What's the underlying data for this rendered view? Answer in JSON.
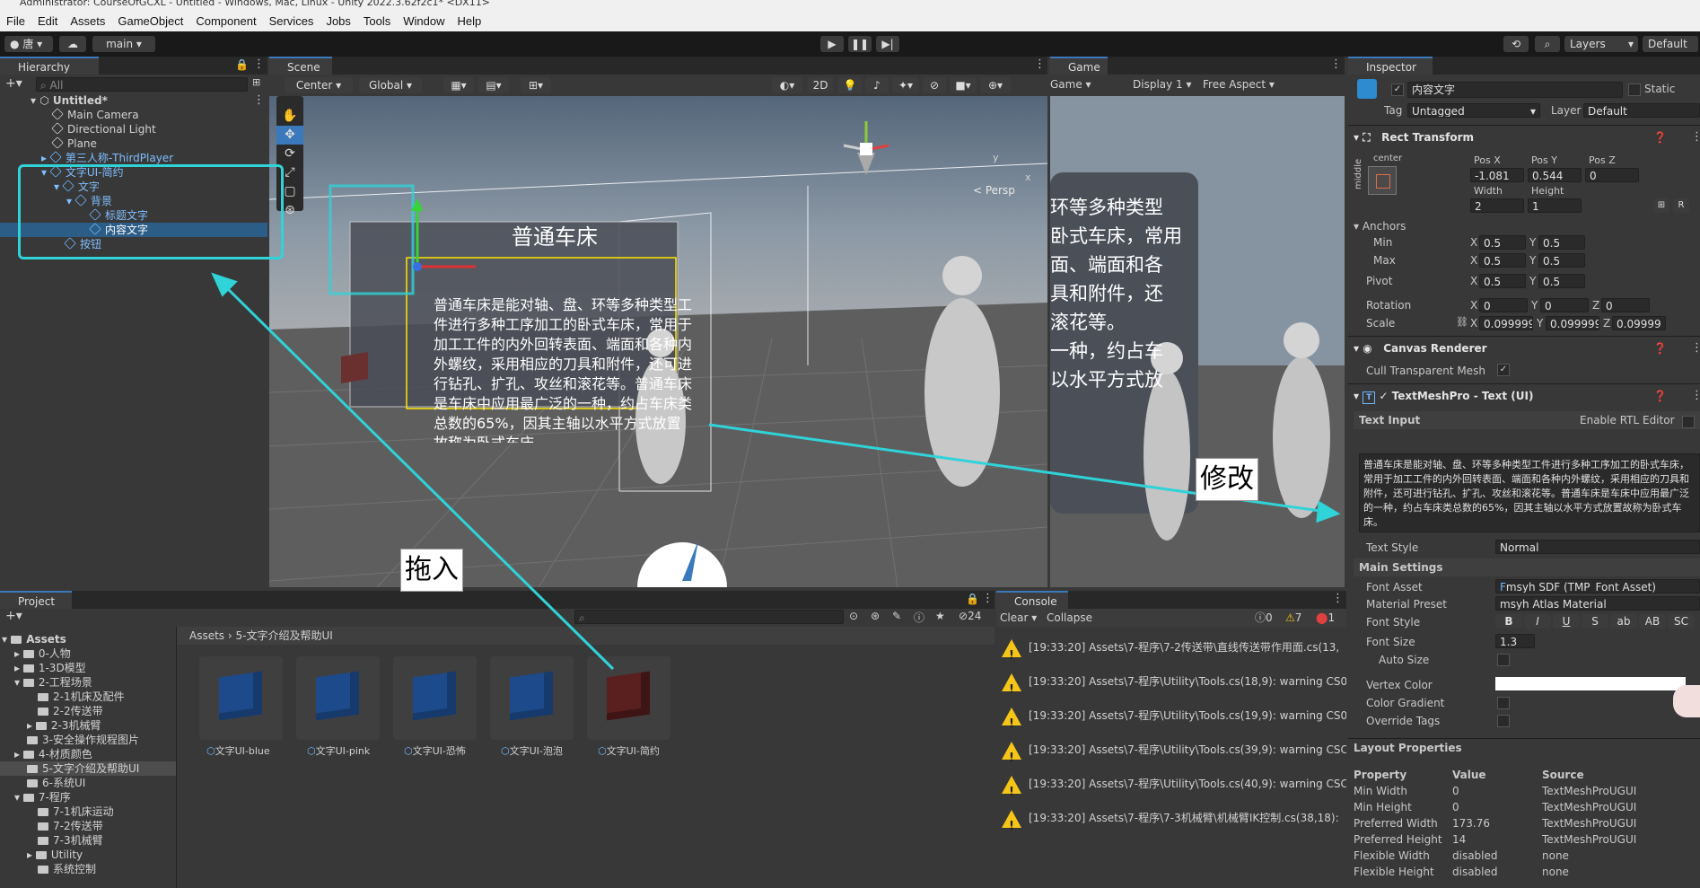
{
  "window": {
    "title": "Administrator: CourseOfGCXL - Untitled - Windows, Mac, Linux - Unity 2022.3.62f2c1* <DX11>"
  },
  "menu": [
    "File",
    "Edit",
    "Assets",
    "GameObject",
    "Component",
    "Services",
    "Jobs",
    "Tools",
    "Window",
    "Help"
  ],
  "toolbar": {
    "account": "唐",
    "branch": "main",
    "layers": "Layers",
    "layout": "Default"
  },
  "hierarchy": {
    "tab": "Hierarchy",
    "search_placeholder": "All",
    "scene": "Untitled*",
    "items": [
      {
        "label": "Main Camera"
      },
      {
        "label": "Directional Light"
      },
      {
        "label": "Plane"
      },
      {
        "label": "第三人称-ThirdPlayer"
      },
      {
        "label": "文字UI-简约"
      },
      {
        "label": "文字"
      },
      {
        "label": "背景"
      },
      {
        "label": "标题文字"
      },
      {
        "label": "内容文字"
      },
      {
        "label": "按钮"
      }
    ]
  },
  "scene": {
    "tab": "Scene",
    "pivot": "Center",
    "space": "Global",
    "mode2d": "2D",
    "persp": "< Persp",
    "gizmo_axes": [
      "y",
      "x"
    ],
    "ui_title": "普通车床",
    "ui_body": "普通车床是能对轴、盘、环等多种类型工件进行多种工序加工的卧式车床，常用于加工工件的内外回转表面、端面和各种内外螺纹，采用相应的刀具和附件，还可进行钻孔、扩孔、攻丝和滚花等。普通车床是车床中应用最广泛的一种，约占车床类总数的65%，因其主轴以水平方式放置故称为卧式车床。"
  },
  "game": {
    "tab": "Game",
    "dropdown": "Game",
    "display": "Display 1",
    "aspect": "Free Aspect",
    "text_lines": [
      "环等多种类型",
      "卧式车床，常用",
      "面、端面和各",
      "具和附件，还",
      "滚花等。",
      "一种，约占车",
      "以水平方式放"
    ]
  },
  "inspector": {
    "tab": "Inspector",
    "object_name": "内容文字",
    "static_label": "Static",
    "tag_label": "Tag",
    "tag": "Untagged",
    "layer_label": "Layer",
    "layer": "Default",
    "rect_transform": {
      "title": "Rect Transform",
      "anchor_preset": "center",
      "side": "middle",
      "pos_x_label": "Pos X",
      "pos_x": "-1.081",
      "pos_y_label": "Pos Y",
      "pos_y": "0.544",
      "pos_z_label": "Pos Z",
      "pos_z": "0",
      "width_label": "Width",
      "width": "2",
      "height_label": "Height",
      "height": "1",
      "r_button": "R",
      "anchors_label": "Anchors",
      "min_label": "Min",
      "min_x": "0.5",
      "min_y": "0.5",
      "max_label": "Max",
      "max_x": "0.5",
      "max_y": "0.5",
      "pivot_label": "Pivot",
      "pivot_x": "0.5",
      "pivot_y": "0.5",
      "rotation_label": "Rotation",
      "rot_x": "0",
      "rot_y": "0",
      "rot_z": "0",
      "scale_label": "Scale",
      "scale_x": "0.099999",
      "scale_y": "0.099999",
      "scale_z": "0.09999"
    },
    "canvas_renderer": {
      "title": "Canvas Renderer",
      "cull_label": "Cull Transparent Mesh"
    },
    "tmp": {
      "title": "TextMeshPro - Text (UI)",
      "text_input_label": "Text Input",
      "rtl_label": "Enable RTL Editor",
      "text": "普通车床是能对轴、盘、环等多种类型工件进行多种工序加工的卧式车床，常用于加工工件的内外回转表面、端面和各种内外螺纹，采用相应的刀具和附件，还可进行钻孔、扩孔、攻丝和滚花等。普通车床是车床中应用最广泛的一种，约占车床类总数的65%，因其主轴以水平方式放置故称为卧式车床。",
      "text_style_label": "Text Style",
      "text_style": "Normal",
      "main_settings": "Main Settings",
      "font_asset_label": "Font Asset",
      "font_asset": "msyh SDF (TMP_Font Asset)",
      "material_label": "Material Preset",
      "material": "msyh Atlas Material",
      "font_style_label": "Font Style",
      "style_buttons": [
        "B",
        "I",
        "U",
        "S",
        "ab",
        "AB",
        "SC"
      ],
      "font_size_label": "Font Size",
      "font_size": "1.3",
      "auto_size_label": "Auto Size",
      "vertex_color_label": "Vertex Color",
      "gradient_label": "Color Gradient",
      "override_label": "Override Tags"
    },
    "layout_properties": {
      "title": "Layout Properties",
      "headers": [
        "Property",
        "Value",
        "Source"
      ],
      "rows": [
        [
          "Min Width",
          "0",
          "TextMeshProUGUI"
        ],
        [
          "Min Height",
          "0",
          "TextMeshProUGUI"
        ],
        [
          "Preferred Width",
          "173.76",
          "TextMeshProUGUI"
        ],
        [
          "Preferred Height",
          "14",
          "TextMeshProUGUI"
        ],
        [
          "Flexible Width",
          "disabled",
          "none"
        ],
        [
          "Flexible Height",
          "disabled",
          "none"
        ]
      ]
    }
  },
  "project": {
    "tab": "Project",
    "breadcrumb": [
      "Assets",
      "5-文字介绍及帮助UI"
    ],
    "hidden_count": "24",
    "tree": [
      {
        "label": "Assets",
        "depth": 0
      },
      {
        "label": "0-人物",
        "depth": 1
      },
      {
        "label": "1-3D模型",
        "depth": 1
      },
      {
        "label": "2-工程场景",
        "depth": 1
      },
      {
        "label": "2-1机床及配件",
        "depth": 2
      },
      {
        "label": "2-2传送带",
        "depth": 2
      },
      {
        "label": "2-3机械臂",
        "depth": 2
      },
      {
        "label": "3-安全操作规程图片",
        "depth": 1
      },
      {
        "label": "4-材质颜色",
        "depth": 1
      },
      {
        "label": "5-文字介绍及帮助UI",
        "depth": 1
      },
      {
        "label": "6-系统UI",
        "depth": 1
      },
      {
        "label": "7-程序",
        "depth": 1
      },
      {
        "label": "7-1机床运动",
        "depth": 2
      },
      {
        "label": "7-2传送带",
        "depth": 2
      },
      {
        "label": "7-3机械臂",
        "depth": 2
      },
      {
        "label": "Utility",
        "depth": 2
      },
      {
        "label": "系统控制",
        "depth": 2
      }
    ],
    "assets": [
      {
        "label": "文字UI-blue"
      },
      {
        "label": "文字UI-pink"
      },
      {
        "label": "文字UI-恐怖"
      },
      {
        "label": "文字UI-泡泡"
      },
      {
        "label": "文字UI-简约"
      }
    ]
  },
  "console": {
    "tab": "Console",
    "clear": "Clear",
    "collapse": "Collapse",
    "log_count": "0",
    "warn_count": "7",
    "error_count": "1",
    "messages": [
      "[19:33:20] Assets\\7-程序\\7-2传送带\\直线传送带作用面.cs(13,",
      "[19:33:20] Assets\\7-程序\\Utility\\Tools.cs(18,9): warning CS0",
      "[19:33:20] Assets\\7-程序\\Utility\\Tools.cs(19,9): warning CS0",
      "[19:33:20] Assets\\7-程序\\Utility\\Tools.cs(39,9): warning CSC",
      "[19:33:20] Assets\\7-程序\\Utility\\Tools.cs(40,9): warning CSC",
      "[19:33:20] Assets\\7-程序\\7-3机械臂\\机械臂IK控制.cs(38,18):"
    ]
  },
  "annotations": {
    "drag": "拖入",
    "modify": "修改"
  },
  "colors": {
    "accent": "#3a79bb",
    "selection": "#2c5d87",
    "annotation": "#2fd3d8",
    "warning": "#f5c518"
  }
}
